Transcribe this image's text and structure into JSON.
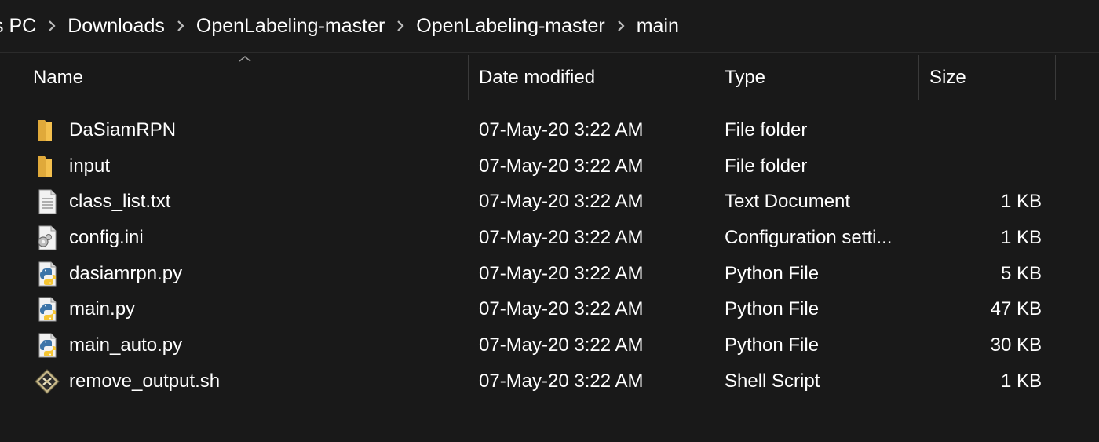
{
  "breadcrumb": {
    "items": [
      {
        "label": "s PC"
      },
      {
        "label": "Downloads"
      },
      {
        "label": "OpenLabeling-master"
      },
      {
        "label": "OpenLabeling-master"
      },
      {
        "label": "main"
      }
    ]
  },
  "columns": {
    "name": "Name",
    "date_modified": "Date modified",
    "type": "Type",
    "size": "Size"
  },
  "files": [
    {
      "name": "DaSiamRPN",
      "date": "07-May-20 3:22 AM",
      "type": "File folder",
      "size": "",
      "icon": "folder-icon"
    },
    {
      "name": "input",
      "date": "07-May-20 3:22 AM",
      "type": "File folder",
      "size": "",
      "icon": "folder-icon"
    },
    {
      "name": "class_list.txt",
      "date": "07-May-20 3:22 AM",
      "type": "Text Document",
      "size": "1 KB",
      "icon": "text-file-icon"
    },
    {
      "name": "config.ini",
      "date": "07-May-20 3:22 AM",
      "type": "Configuration setti...",
      "size": "1 KB",
      "icon": "config-file-icon"
    },
    {
      "name": "dasiamrpn.py",
      "date": "07-May-20 3:22 AM",
      "type": "Python File",
      "size": "5 KB",
      "icon": "python-file-icon"
    },
    {
      "name": "main.py",
      "date": "07-May-20 3:22 AM",
      "type": "Python File",
      "size": "47 KB",
      "icon": "python-file-icon"
    },
    {
      "name": "main_auto.py",
      "date": "07-May-20 3:22 AM",
      "type": "Python File",
      "size": "30 KB",
      "icon": "python-file-icon"
    },
    {
      "name": "remove_output.sh",
      "date": "07-May-20 3:22 AM",
      "type": "Shell Script",
      "size": "1 KB",
      "icon": "shell-script-icon"
    }
  ],
  "colors": {
    "background": "#191919",
    "text": "#ffffff",
    "folder": "#f4c04e",
    "divider": "#3a3a3a"
  }
}
